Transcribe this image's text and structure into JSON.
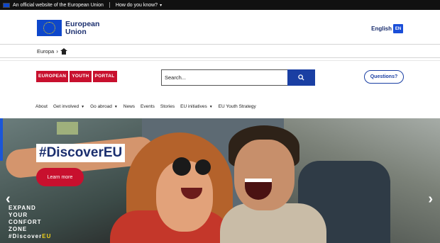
{
  "topbar": {
    "official_text": "An official website of the European Union",
    "howdoyouknow": "How do you know?"
  },
  "header": {
    "eu_logo_line1": "European",
    "eu_logo_line2": "Union",
    "language": "English",
    "language_code": "EN"
  },
  "breadcrumb": {
    "item": "Europa",
    "separator": "›"
  },
  "portal": {
    "logo_words": [
      "EUROPEAN",
      "YOUTH",
      "PORTAL"
    ]
  },
  "search": {
    "placeholder": "Search..."
  },
  "questions_label": "Questions?",
  "nav": [
    {
      "label": "About",
      "dropdown": false
    },
    {
      "label": "Get involved",
      "dropdown": true
    },
    {
      "label": "Go abroad",
      "dropdown": true
    },
    {
      "label": "News",
      "dropdown": false
    },
    {
      "label": "Events",
      "dropdown": false
    },
    {
      "label": "Stories",
      "dropdown": false
    },
    {
      "label": "EU initiatives",
      "dropdown": true
    },
    {
      "label": "EU Youth Strategy",
      "dropdown": false
    }
  ],
  "hero": {
    "title": "#DiscoverEU",
    "cta": "Learn more",
    "prev_icon": "chevron-left-icon",
    "next_icon": "chevron-right-icon",
    "tagline_lines": [
      "EXPAND",
      "YOUR",
      "CONFORT",
      "ZONE"
    ],
    "hashtag_prefix": "#Discover",
    "hashtag_suffix": "EU"
  },
  "colors": {
    "eu_blue": "#0e47cb",
    "portal_red": "#c8102e",
    "search_blue": "#1a3fa3",
    "tagline_yellow": "#f0d21a"
  }
}
